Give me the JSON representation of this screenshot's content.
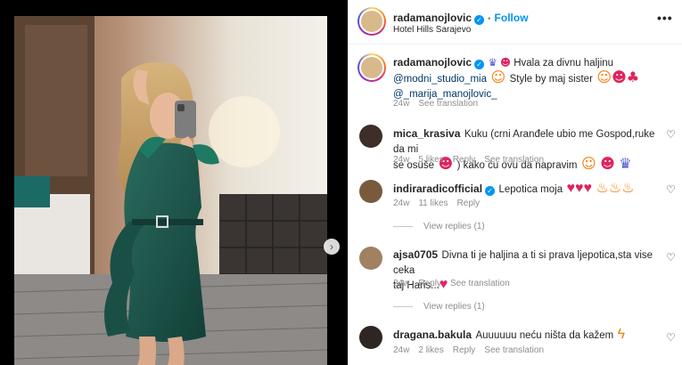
{
  "post": {
    "username": "radamanojlovic",
    "follow_label": "Follow",
    "location": "Hotel Hills Sarajevo",
    "more_icon": "more-options-icon"
  },
  "caption": {
    "username": "radamanojlovic",
    "text_1": "Hvala za divnu haljinu",
    "mention_1": "@modni_studio_mia",
    "text_2": "Style by maj sister",
    "mention_2": "@_marija_manojlovic_",
    "time": "24w",
    "see_translation": "See translation"
  },
  "comments": [
    {
      "username": "mica_krasiva",
      "text_1": "Kuku (crni Aranđele ubio me Gospod,ruke da mi",
      "text_2": "se osuše",
      "text_3": ") kako ću ovu da napravim",
      "time": "24w",
      "likes": "5 likes",
      "reply": "Reply",
      "see_translation": "See translation"
    },
    {
      "username": "indiraradicofficial",
      "text": "Lepotica moja",
      "time": "24w",
      "likes": "11 likes",
      "reply": "Reply",
      "view_replies": "View replies (1)"
    },
    {
      "username": "ajsa0705",
      "text_1": "Divna ti je haljina a ti si prava ljepotica,sta vise ceka",
      "text_2": "taj Haris...",
      "time": "24w",
      "reply": "Reply",
      "see_translation": "See translation",
      "view_replies": "View replies (1)"
    },
    {
      "username": "dragana.bakula",
      "text": "Auuuuuu neću ništa da kažem",
      "time": "24w",
      "likes": "2 likes",
      "reply": "Reply",
      "see_translation": "See translation"
    }
  ],
  "colors": {
    "accent": "#0095f6",
    "muted": "#8e8e8e",
    "dress": "#1f5a4f"
  }
}
